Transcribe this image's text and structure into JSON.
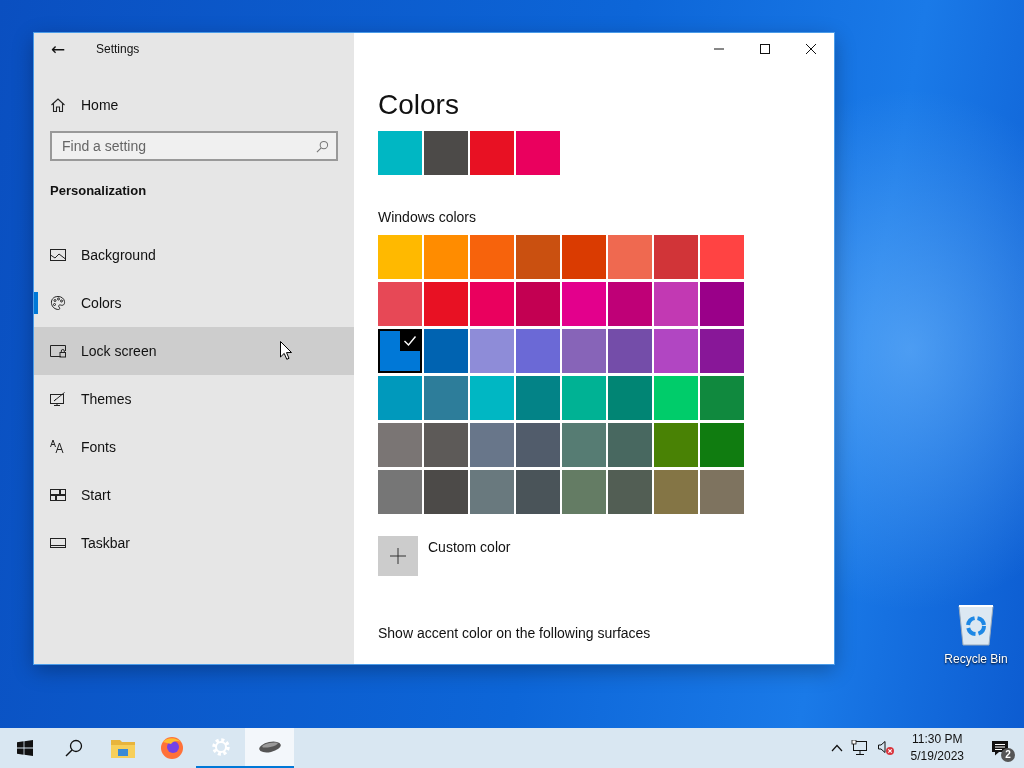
{
  "window": {
    "title": "Settings",
    "back": "←"
  },
  "sidebar": {
    "home": "Home",
    "search": {
      "placeholder": "Find a setting"
    },
    "section": "Personalization",
    "items": [
      {
        "label": "Background",
        "kind": "background",
        "selected": false,
        "hovered": false
      },
      {
        "label": "Colors",
        "kind": "colors",
        "selected": true,
        "hovered": false
      },
      {
        "label": "Lock screen",
        "kind": "lock",
        "selected": false,
        "hovered": true
      },
      {
        "label": "Themes",
        "kind": "themes",
        "selected": false,
        "hovered": false
      },
      {
        "label": "Fonts",
        "kind": "fonts",
        "selected": false,
        "hovered": false
      },
      {
        "label": "Start",
        "kind": "start",
        "selected": false,
        "hovered": false
      },
      {
        "label": "Taskbar",
        "kind": "taskbar",
        "selected": false,
        "hovered": false
      }
    ]
  },
  "content": {
    "title": "Colors",
    "recent_colors": [
      {
        "color": "#00b7c3"
      },
      {
        "color": "#4c4a48"
      },
      {
        "color": "#e81123"
      },
      {
        "color": "#ea005e"
      }
    ],
    "windows_colors_label": "Windows colors",
    "windows_colors": [
      {
        "color": "#ffb900",
        "selected": false
      },
      {
        "color": "#ff8c00",
        "selected": false
      },
      {
        "color": "#f7630c",
        "selected": false
      },
      {
        "color": "#ca5010",
        "selected": false
      },
      {
        "color": "#da3b01",
        "selected": false
      },
      {
        "color": "#ef6950",
        "selected": false
      },
      {
        "color": "#d13438",
        "selected": false
      },
      {
        "color": "#ff4343",
        "selected": false
      },
      {
        "color": "#e74856",
        "selected": false
      },
      {
        "color": "#e81123",
        "selected": false
      },
      {
        "color": "#ea005e",
        "selected": false
      },
      {
        "color": "#c30052",
        "selected": false
      },
      {
        "color": "#e3008c",
        "selected": false
      },
      {
        "color": "#bf0077",
        "selected": false
      },
      {
        "color": "#c239b3",
        "selected": false
      },
      {
        "color": "#9a0089",
        "selected": false
      },
      {
        "color": "#0078d7",
        "selected": true
      },
      {
        "color": "#0063b1",
        "selected": false
      },
      {
        "color": "#8e8cd8",
        "selected": false
      },
      {
        "color": "#6b69d6",
        "selected": false
      },
      {
        "color": "#8764b8",
        "selected": false
      },
      {
        "color": "#744da9",
        "selected": false
      },
      {
        "color": "#b146c2",
        "selected": false
      },
      {
        "color": "#881798",
        "selected": false
      },
      {
        "color": "#0099bc",
        "selected": false
      },
      {
        "color": "#2d7d9a",
        "selected": false
      },
      {
        "color": "#00b7c3",
        "selected": false
      },
      {
        "color": "#038387",
        "selected": false
      },
      {
        "color": "#00b294",
        "selected": false
      },
      {
        "color": "#018574",
        "selected": false
      },
      {
        "color": "#00cc6a",
        "selected": false
      },
      {
        "color": "#10893e",
        "selected": false
      },
      {
        "color": "#7a7574",
        "selected": false
      },
      {
        "color": "#5d5a58",
        "selected": false
      },
      {
        "color": "#68768a",
        "selected": false
      },
      {
        "color": "#515c6b",
        "selected": false
      },
      {
        "color": "#567c73",
        "selected": false
      },
      {
        "color": "#486860",
        "selected": false
      },
      {
        "color": "#498205",
        "selected": false
      },
      {
        "color": "#107c10",
        "selected": false
      },
      {
        "color": "#767676",
        "selected": false
      },
      {
        "color": "#4c4a48",
        "selected": false
      },
      {
        "color": "#69797e",
        "selected": false
      },
      {
        "color": "#4a5459",
        "selected": false
      },
      {
        "color": "#647c64",
        "selected": false
      },
      {
        "color": "#525e54",
        "selected": false
      },
      {
        "color": "#847545",
        "selected": false
      },
      {
        "color": "#7e735f",
        "selected": false
      }
    ],
    "custom_color": "Custom color",
    "surfaces_label": "Show accent color on the following surfaces"
  },
  "desktop": {
    "icons": [
      {
        "label": "Recycle Bin"
      }
    ]
  },
  "taskbar": {
    "apps": [
      {
        "kind": "start",
        "running": false,
        "selected": false
      },
      {
        "kind": "search",
        "running": false,
        "selected": false
      },
      {
        "kind": "explorer",
        "running": false,
        "selected": false
      },
      {
        "kind": "browser",
        "running": false,
        "selected": false
      },
      {
        "kind": "settings",
        "running": true,
        "selected": false
      },
      {
        "kind": "mouse",
        "running": true,
        "selected": true
      }
    ],
    "time": "11:30 PM",
    "date": "5/19/2023",
    "notifications": "2"
  }
}
